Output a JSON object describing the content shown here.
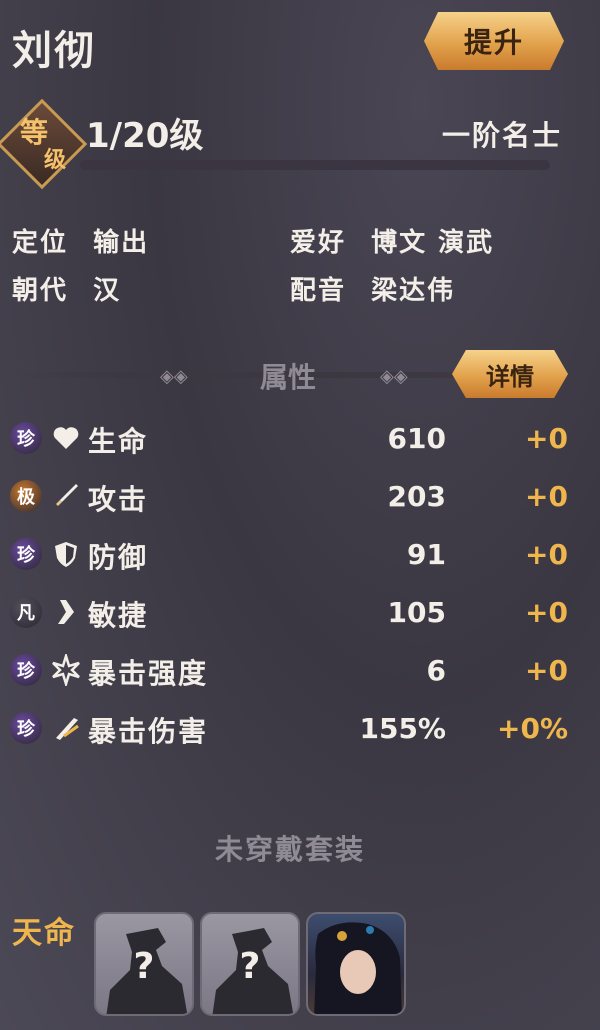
{
  "hero": {
    "name": "刘彻"
  },
  "buttons": {
    "upgrade": "提升",
    "details": "详情"
  },
  "level": {
    "badge_top": "等",
    "badge_bottom": "级",
    "value": "1/20级",
    "rank": "一阶名士",
    "progress": 0.0
  },
  "info": {
    "position_label": "定位",
    "position_value": "输出",
    "dynasty_label": "朝代",
    "dynasty_value": "汉",
    "hobby_label": "爱好",
    "hobby_value": "博文 演武",
    "voice_label": "配音",
    "voice_value": "梁达伟"
  },
  "attributes": {
    "title": "属性",
    "stats": [
      {
        "rarity": "珍",
        "rarity_color": "#6b4aa0",
        "icon": "heart-icon",
        "label": "生命",
        "value": "610",
        "bonus": "+0"
      },
      {
        "rarity": "极",
        "rarity_color": "#c9782e",
        "icon": "sword-icon",
        "label": "攻击",
        "value": "203",
        "bonus": "+0"
      },
      {
        "rarity": "珍",
        "rarity_color": "#6b4aa0",
        "icon": "shield-icon",
        "label": "防御",
        "value": "91",
        "bonus": "+0"
      },
      {
        "rarity": "凡",
        "rarity_color": "#55505c",
        "icon": "boot-icon",
        "label": "敏捷",
        "value": "105",
        "bonus": "+0"
      },
      {
        "rarity": "珍",
        "rarity_color": "#6b4aa0",
        "icon": "star-burst-icon",
        "label": "暴击强度",
        "value": "6",
        "bonus": "+0"
      },
      {
        "rarity": "珍",
        "rarity_color": "#6b4aa0",
        "icon": "slash-icon",
        "label": "暴击伤害",
        "value": "155%",
        "bonus": "+0%"
      }
    ]
  },
  "set": {
    "status": "未穿戴套装"
  },
  "fate": {
    "label": "天命",
    "unknown_mark": "?"
  }
}
